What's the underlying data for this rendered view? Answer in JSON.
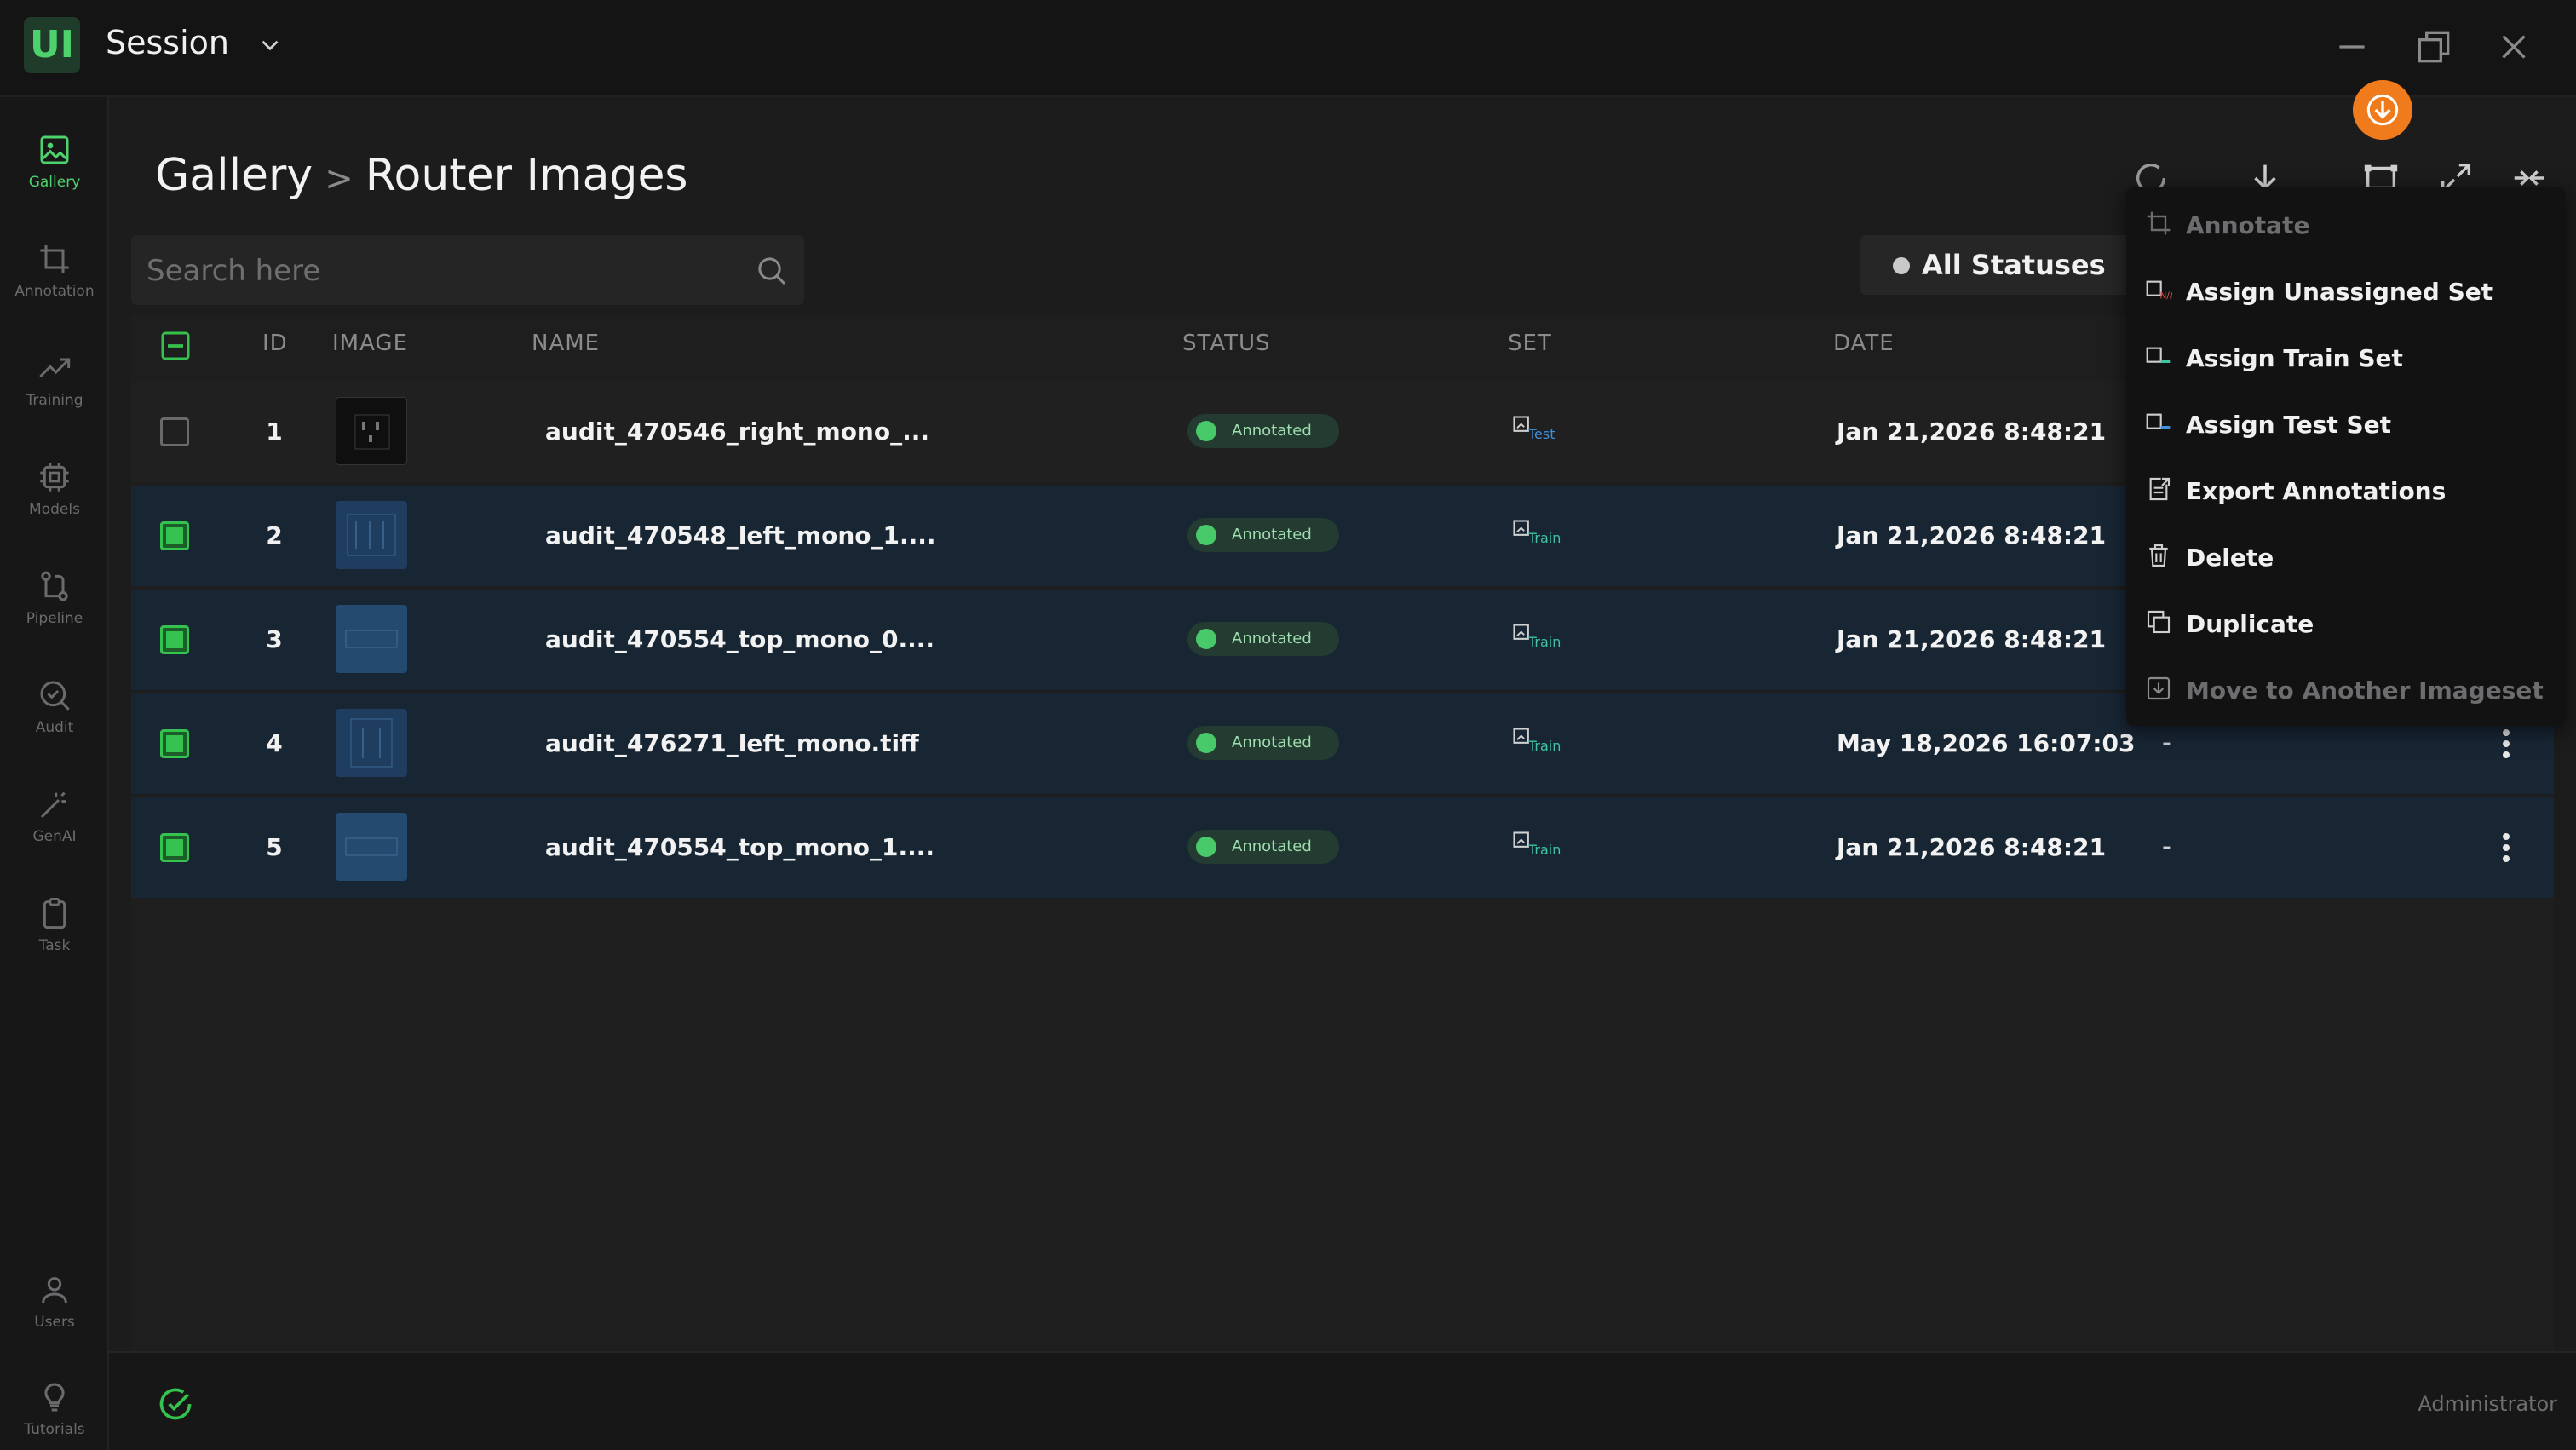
{
  "app": {
    "logo": "UI",
    "session_title": "Session"
  },
  "sidebar": {
    "items": [
      {
        "label": "Gallery",
        "icon": "image-icon",
        "active": true
      },
      {
        "label": "Annotation",
        "icon": "crop-icon"
      },
      {
        "label": "Training",
        "icon": "trend-icon"
      },
      {
        "label": "Models",
        "icon": "chip-icon"
      },
      {
        "label": "Pipeline",
        "icon": "pipeline-icon"
      },
      {
        "label": "Audit",
        "icon": "audit-icon"
      },
      {
        "label": "GenAI",
        "icon": "wand-icon"
      },
      {
        "label": "Task",
        "icon": "clipboard-icon"
      }
    ],
    "bottom": [
      {
        "label": "Users",
        "icon": "user-icon"
      },
      {
        "label": "Tutorials",
        "icon": "bulb-icon"
      }
    ]
  },
  "breadcrumb": {
    "root": "Gallery",
    "separator": ">",
    "current": "Router Images"
  },
  "search": {
    "placeholder": "Search here"
  },
  "filter": {
    "status": "All Statuses"
  },
  "table": {
    "headers": {
      "id": "ID",
      "image": "IMAGE",
      "name": "NAME",
      "status": "STATUS",
      "set": "SET",
      "date": "DATE"
    },
    "rows": [
      {
        "id": "1",
        "name": "audit_470546_right_mono_...",
        "status": "Annotated",
        "set": "Test",
        "date": "Jan 21,2026 8:48:21",
        "extra": "",
        "selected": false
      },
      {
        "id": "2",
        "name": "audit_470548_left_mono_1....",
        "status": "Annotated",
        "set": "Train",
        "date": "Jan 21,2026 8:48:21",
        "extra": "",
        "selected": true
      },
      {
        "id": "3",
        "name": "audit_470554_top_mono_0....",
        "status": "Annotated",
        "set": "Train",
        "date": "Jan 21,2026 8:48:21",
        "extra": "",
        "selected": true
      },
      {
        "id": "4",
        "name": "audit_476271_left_mono.tiff",
        "status": "Annotated",
        "set": "Train",
        "date": "May 18,2026 16:07:03",
        "extra": "-",
        "selected": true
      },
      {
        "id": "5",
        "name": "audit_470554_top_mono_1....",
        "status": "Annotated",
        "set": "Train",
        "date": "Jan 21,2026 8:48:21",
        "extra": "-",
        "selected": true
      }
    ]
  },
  "menu": {
    "items": [
      {
        "label": "Annotate",
        "icon": "crop-icon",
        "disabled": true
      },
      {
        "label": "Assign Unassigned Set",
        "icon": "set-na-icon",
        "disabled": false
      },
      {
        "label": "Assign Train Set",
        "icon": "set-train-icon",
        "disabled": false
      },
      {
        "label": "Assign Test Set",
        "icon": "set-test-icon",
        "disabled": false
      },
      {
        "label": "Export Annotations",
        "icon": "export-icon",
        "disabled": false
      },
      {
        "label": "Delete",
        "icon": "trash-icon",
        "disabled": false
      },
      {
        "label": "Duplicate",
        "icon": "duplicate-icon",
        "disabled": false
      },
      {
        "label": "Move to Another Imageset",
        "icon": "move-icon",
        "disabled": true
      }
    ]
  },
  "footer": {
    "user_role": "Administrator"
  },
  "colors": {
    "accent": "#4ed26d",
    "selected_row": "#182634",
    "fab": "#f07b1c",
    "test_set": "#3d8fe0",
    "train_set": "#3fc3a0"
  }
}
